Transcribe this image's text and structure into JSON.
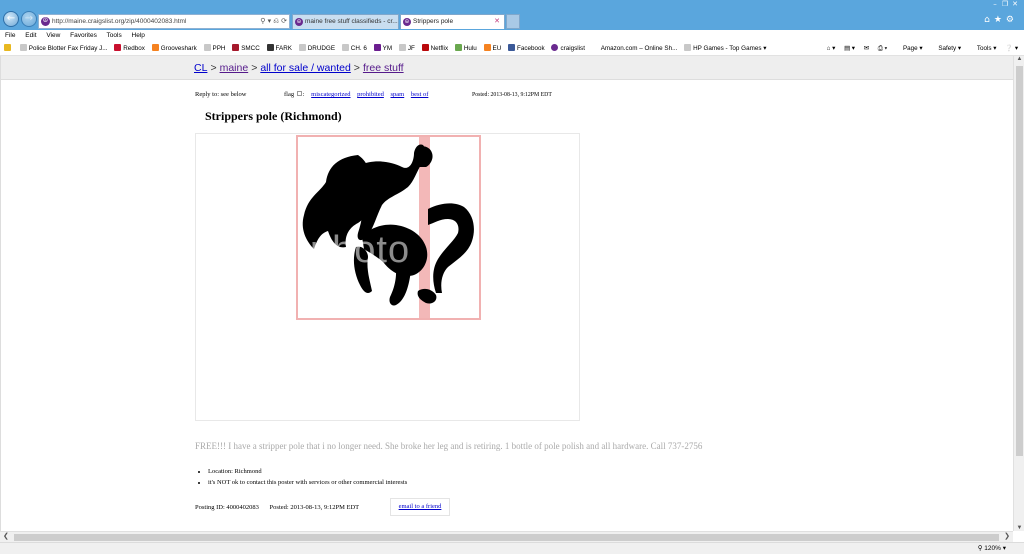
{
  "browser": {
    "address_url": "http://maine.craigslist.org/zip/4000402083.html",
    "address_host": "maine.craigslist.org",
    "tabs": [
      {
        "label": "maine free stuff classifieds - cr..."
      },
      {
        "label": "Strippers pole"
      }
    ],
    "menu": [
      "File",
      "Edit",
      "View",
      "Favorites",
      "Tools",
      "Help"
    ],
    "favorites": [
      "Police Blotter Fax Friday J...",
      "Redbox",
      "Grooveshark",
      "PPH",
      "SMCC",
      "FARK",
      "DRUDGE",
      "CH. 6",
      "YM",
      "JF",
      "Netflix",
      "Hulu",
      "EU",
      "Facebook",
      "craigslist",
      "Amazon.com – Online Sh...",
      "HP Games - Top Games"
    ],
    "toolbar": {
      "page": "Page",
      "safety": "Safety",
      "tools": "Tools"
    },
    "zoom": "120%"
  },
  "breadcrumb": {
    "cl": "CL",
    "region": "maine",
    "category": "all for sale / wanted",
    "subcategory": "free stuff"
  },
  "post": {
    "reply_to": "Reply to: see below",
    "flag_label": "flag",
    "flags": [
      "miscategorized",
      "prohibited",
      "spam",
      "best of"
    ],
    "posted_top": "Posted: 2013-08-13, 9:12PM EDT",
    "title": "Strippers pole (Richmond)",
    "watermark": "photo",
    "body": "FREE!!! I have a stripper pole that i no longer need. She broke her leg and is retiring. 1 bottle of pole polish and all hardware. Call 737-2756",
    "attributes": [
      "Location: Richmond",
      "it's NOT ok to contact this poster with services or other commercial interests"
    ],
    "posting_id": "Posting ID: 4000402083",
    "posted_bottom": "Posted: 2013-08-13, 9:12PM EDT",
    "email_friend": "email to a friend"
  },
  "colors": {
    "chrome_blue": "#5aa6dd",
    "link": "#0000cc",
    "visited": "#551a8b",
    "pole": "#f3b8b8"
  }
}
